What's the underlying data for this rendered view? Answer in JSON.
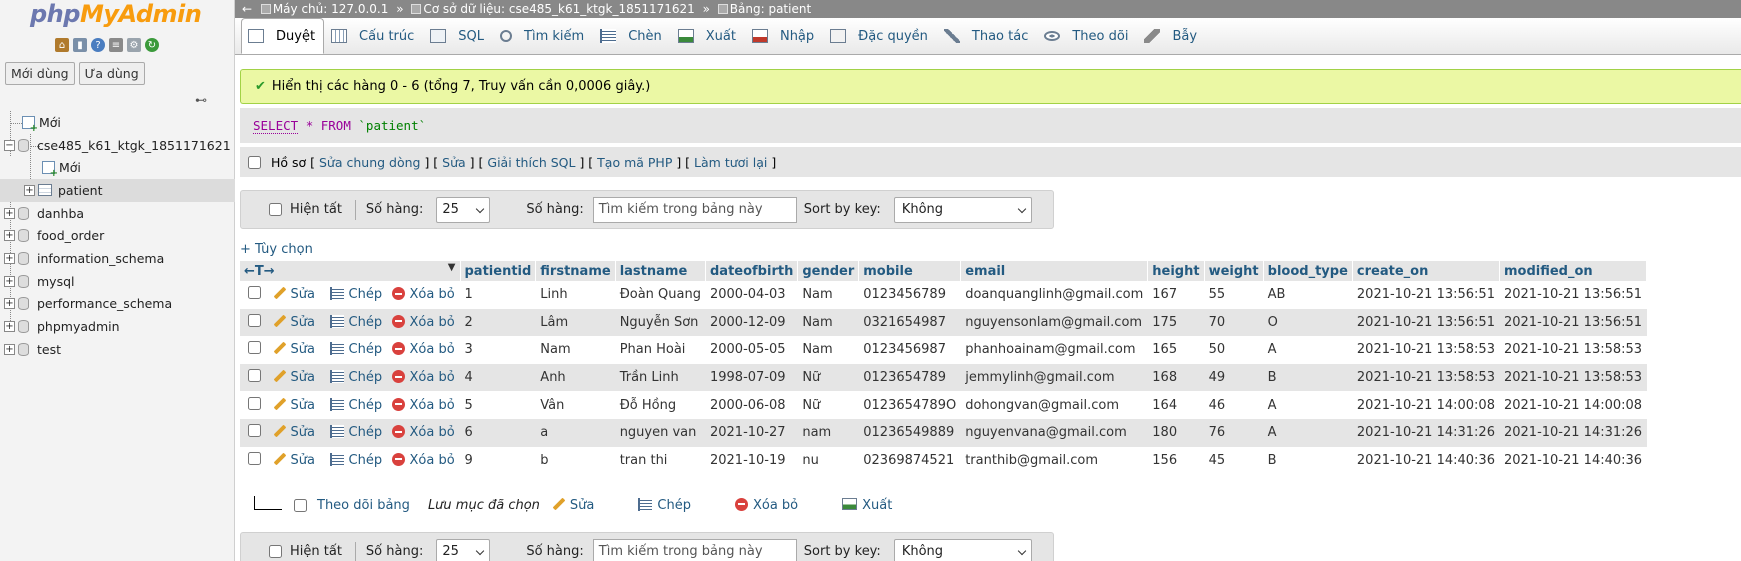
{
  "logo": {
    "part1": "php",
    "part2": "MyAdmin"
  },
  "nav": {
    "recent_label": "Mới dùng",
    "favorites_label": "Ưa dùng",
    "tree": [
      {
        "label": "Mới"
      },
      {
        "label": "cse485_k61_ktgk_1851171621"
      },
      {
        "label": "Mới"
      },
      {
        "label": "patient"
      },
      {
        "label": "danhba"
      },
      {
        "label": "food_order"
      },
      {
        "label": "information_schema"
      },
      {
        "label": "mysql"
      },
      {
        "label": "performance_schema"
      },
      {
        "label": "phpmyadmin"
      },
      {
        "label": "test"
      }
    ]
  },
  "breadcrumb": {
    "server": "Máy chủ: 127.0.0.1",
    "database": "Cơ sở dữ liệu: cse485_k61_ktgk_1851171621",
    "table": "Bảng: patient"
  },
  "tabs": [
    "Duyệt",
    "Cấu trúc",
    "SQL",
    "Tìm kiếm",
    "Chèn",
    "Xuất",
    "Nhập",
    "Đặc quyền",
    "Thao tác",
    "Theo dõi",
    "Bẫy"
  ],
  "message": "Hiển thị các hàng 0 - 6 (tổng 7, Truy vấn cần 0,0006 giây.)",
  "sql": {
    "select": "SELECT",
    "star": "*",
    "from": "FROM",
    "table": "`patient`"
  },
  "profiling": {
    "label": "Hồ sơ",
    "links": [
      "Sửa chung dòng",
      "Sửa",
      "Giải thích SQL",
      "Tạo mã PHP",
      "Làm tươi lại"
    ]
  },
  "navbar": {
    "show_all": "Hiện tất",
    "rows_label": "Số hàng:",
    "rows_value": "25",
    "filter_label": "Số hàng:",
    "filter_placeholder": "Tìm kiếm trong bảng này",
    "sort_label": "Sort by key:",
    "sort_value": "Không"
  },
  "options_link": "+ Tùy chọn",
  "table": {
    "columns": [
      "patientid",
      "firstname",
      "lastname",
      "dateofbirth",
      "gender",
      "mobile",
      "email",
      "height",
      "weight",
      "blood_type",
      "create_on",
      "modified_on"
    ],
    "actions": {
      "edit": "Sửa",
      "copy": "Chép",
      "delete": "Xóa bỏ"
    },
    "rows": [
      [
        "1",
        "Linh",
        "Đoàn Quang",
        "2000-04-03",
        "Nam",
        "0123456789",
        "doanquanglinh@gmail.com",
        "167",
        "55",
        "AB",
        "2021-10-21 13:56:51",
        "2021-10-21 13:56:51"
      ],
      [
        "2",
        "Lâm",
        "Nguyễn Sơn",
        "2000-12-09",
        "Nam",
        "0321654987",
        "nguyensonlam@gmail.com",
        "175",
        "70",
        "O",
        "2021-10-21 13:56:51",
        "2021-10-21 13:56:51"
      ],
      [
        "3",
        "Nam",
        "Phan Hoài",
        "2000-05-05",
        "Nam",
        "0123456987",
        "phanhoainam@gmail.com",
        "165",
        "50",
        "A",
        "2021-10-21 13:58:53",
        "2021-10-21 13:58:53"
      ],
      [
        "4",
        "Anh",
        "Trần Linh",
        "1998-07-09",
        "Nữ",
        "0123654789",
        "jemmylinh@gmail.com",
        "168",
        "49",
        "B",
        "2021-10-21 13:58:53",
        "2021-10-21 13:58:53"
      ],
      [
        "5",
        "Vân",
        "Đỗ Hồng",
        "2000-06-08",
        "Nữ",
        "0123654789O",
        "dohongvan@gmail.com",
        "164",
        "46",
        "A",
        "2021-10-21 14:00:08",
        "2021-10-21 14:00:08"
      ],
      [
        "6",
        "a",
        "nguyen van",
        "2021-10-27",
        "nam",
        "01236549889",
        "nguyenvana@gmail.com",
        "180",
        "76",
        "A",
        "2021-10-21 14:31:26",
        "2021-10-21 14:31:26"
      ],
      [
        "9",
        "b",
        "tran thi",
        "2021-10-19",
        "nu",
        "02369874521",
        "tranthib@gmail.com",
        "156",
        "45",
        "B",
        "2021-10-21 14:40:36",
        "2021-10-21 14:40:36"
      ]
    ]
  },
  "bottom": {
    "track": "Theo dõi bảng",
    "with_selected": "Lưu mục đã chọn",
    "edit": "Sửa",
    "copy": "Chép",
    "delete": "Xóa bỏ",
    "export": "Xuất"
  }
}
